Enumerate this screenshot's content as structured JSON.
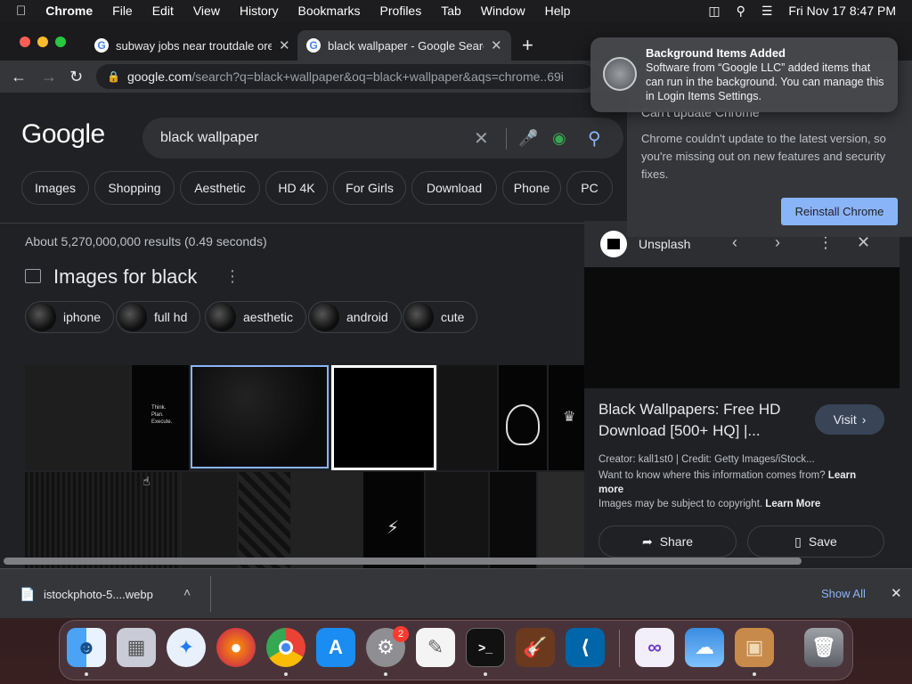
{
  "menubar": {
    "app": "Chrome",
    "items": [
      "File",
      "Edit",
      "View",
      "History",
      "Bookmarks",
      "Profiles",
      "Tab",
      "Window",
      "Help"
    ],
    "datetime": "Fri Nov 17  8:47 PM"
  },
  "tabs": [
    {
      "title": "subway jobs near troutdale ore"
    },
    {
      "title": "black wallpaper - Google Searc"
    }
  ],
  "toolbar": {
    "url_host": "google.com",
    "url_path": "/search?q=black+wallpaper&oq=black+wallpaper&aqs=chrome..69i"
  },
  "google": {
    "logo": "Google",
    "query": "black wallpaper",
    "filters": [
      "Images",
      "Shopping",
      "Aesthetic",
      "HD 4K",
      "For Girls",
      "Download",
      "Phone",
      "PC"
    ],
    "stats": "About 5,270,000,000 results (0.49 seconds)",
    "images_heading": "Images for black",
    "related": [
      "iphone",
      "full hd",
      "aesthetic",
      "android",
      "cute"
    ],
    "tile_text": "Think.\nPlan.\nExecute."
  },
  "panel": {
    "source": "Unsplash",
    "title": "Black Wallpapers: Free HD Download [500+ HQ] |...",
    "visit": "Visit",
    "creator": "Creator: kall1st0 | Credit: Getty Images/iStock...",
    "where_text": "Want to know where this information comes from?",
    "learn_more": "Learn more",
    "copyright": "Images may be subject to copyright.",
    "learn_more2": "Learn More",
    "share": "Share",
    "save": "Save"
  },
  "update_card": {
    "title": "Can't update Chrome",
    "body": "Chrome couldn't update to the latest version, so you're missing out on new features and security fixes.",
    "button": "Reinstall Chrome"
  },
  "notification": {
    "title": "Background Items Added",
    "body": "Software from “Google LLC” added items that can run in the background. You can manage this in Login Items Settings."
  },
  "download": {
    "file": "istockphoto-5....webp",
    "show_all": "Show All"
  },
  "dock": {
    "badge": "2"
  }
}
